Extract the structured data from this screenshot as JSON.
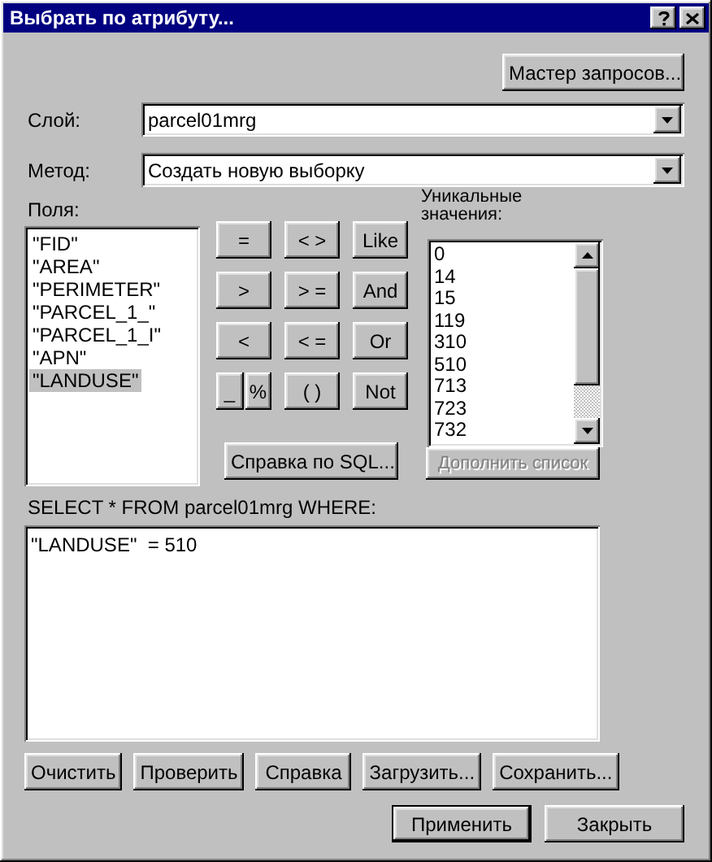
{
  "window": {
    "title": "Выбрать по атрибуту..."
  },
  "wizard_button": "Мастер запросов...",
  "layer": {
    "label": "Слой:",
    "value": "parcel01mrg"
  },
  "method": {
    "label": "Метод:",
    "value": "Создать новую выборку"
  },
  "fields": {
    "label": "Поля:",
    "items": [
      {
        "label": "\"FID\"",
        "selected": false
      },
      {
        "label": "\"AREA\"",
        "selected": false
      },
      {
        "label": "\"PERIMETER\"",
        "selected": false
      },
      {
        "label": "\"PARCEL_1_\"",
        "selected": false
      },
      {
        "label": "\"PARCEL_1_I\"",
        "selected": false
      },
      {
        "label": "\"APN\"",
        "selected": false
      },
      {
        "label": "\"LANDUSE\"",
        "selected": true
      }
    ]
  },
  "operators": [
    {
      "label": "=",
      "kind": "full"
    },
    {
      "label": "< >",
      "kind": "full"
    },
    {
      "label": "Like",
      "kind": "full"
    },
    {
      "label": ">",
      "kind": "full"
    },
    {
      "label": "> =",
      "kind": "full"
    },
    {
      "label": "And",
      "kind": "full"
    },
    {
      "label": "<",
      "kind": "full"
    },
    {
      "label": "< =",
      "kind": "full"
    },
    {
      "label": "Or",
      "kind": "full"
    },
    {
      "label": "_",
      "kind": "half"
    },
    {
      "label": "%",
      "kind": "half"
    },
    {
      "label": "( )",
      "kind": "full"
    },
    {
      "label": "Not",
      "kind": "full"
    }
  ],
  "sql_help_button": "Справка по SQL...",
  "unique_values": {
    "label": "Уникальные значения:",
    "items": [
      "0",
      "14",
      "15",
      "119",
      "310",
      "510",
      "713",
      "723",
      "732"
    ]
  },
  "complete_list_button": {
    "label": "Дополнить список",
    "disabled": true
  },
  "query": {
    "label": "SELECT * FROM parcel01mrg WHERE:",
    "value": "\"LANDUSE\"  = 510"
  },
  "actions": [
    "Очистить",
    "Проверить",
    "Справка",
    "Загрузить...",
    "Сохранить..."
  ],
  "dialog_buttons": [
    {
      "label": "Применить",
      "default": true
    },
    {
      "label": "Закрыть",
      "default": false
    }
  ]
}
